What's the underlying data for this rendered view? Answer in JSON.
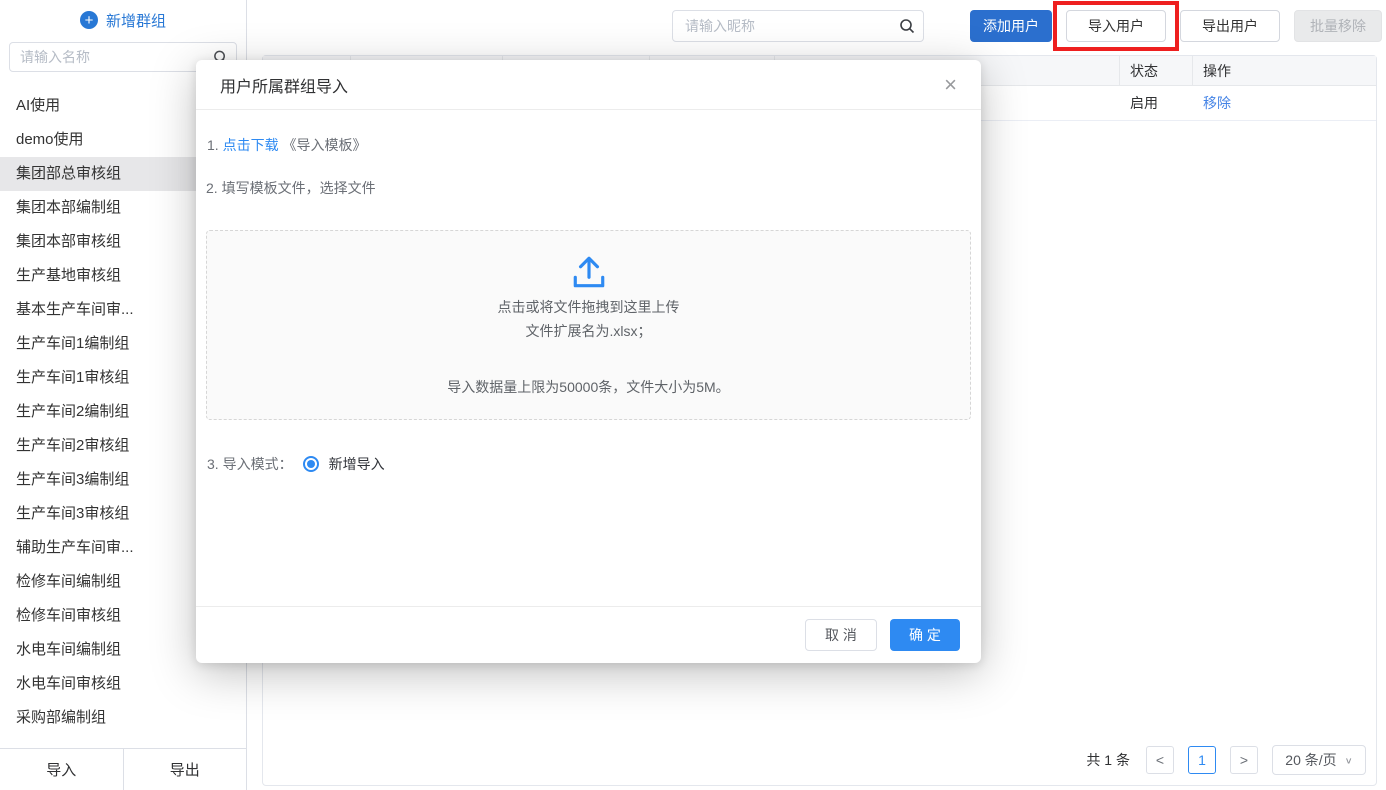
{
  "sidebar": {
    "add_group_label": "新增群组",
    "search_placeholder": "请输入名称",
    "groups": [
      "AI使用",
      "demo使用",
      "集团部总审核组",
      "集团本部编制组",
      "集团本部审核组",
      "生产基地审核组",
      "基本生产车间审...",
      "生产车间1编制组",
      "生产车间1审核组",
      "生产车间2编制组",
      "生产车间2审核组",
      "生产车间3编制组",
      "生产车间3审核组",
      "辅助生产车间审...",
      "检修车间编制组",
      "检修车间审核组",
      "水电车间编制组",
      "水电车间审核组",
      "采购部编制组"
    ],
    "selected_group": "集团部总审核组",
    "import_label": "导入",
    "export_label": "导出"
  },
  "toolbar": {
    "search_placeholder": "请输入昵称",
    "add_user_label": "添加用户",
    "import_user_label": "导入用户",
    "export_user_label": "导出用户",
    "batch_remove_label": "批量移除"
  },
  "table": {
    "headers": [
      "状态",
      "操作"
    ],
    "rows": [
      {
        "status": "启用",
        "action": "移除"
      }
    ]
  },
  "pagination": {
    "total_label": "共 1 条",
    "current_page": "1",
    "page_size_label": "20 条/页"
  },
  "modal": {
    "title": "用户所属群组导入",
    "step1_prefix": "1. ",
    "step1_link": "点击下载",
    "step1_suffix": " 《导入模板》",
    "step2": "2. 填写模板文件，选择文件",
    "upload_line1": "点击或将文件拖拽到这里上传",
    "upload_line2": "文件扩展名为.xlsx；",
    "upload_line3": "导入数据量上限为50000条，文件大小为5M。",
    "step3_label": "3. 导入模式：",
    "radio_label": "新增导入",
    "radio_selected": true,
    "cancel_label": "取 消",
    "confirm_label": "确 定"
  },
  "icons": {
    "plus": "+",
    "close": "×",
    "prev": "<",
    "next": ">",
    "chevron_down": "∨"
  },
  "annotation": {
    "shape": "rectangle",
    "color": "#ee1f1f",
    "target": "import-user-button"
  },
  "colors": {
    "primary_dark": "#2b6fce",
    "primary_bright": "#2e8af2",
    "link_blue": "#4584e6",
    "annotation_red": "#ee1f1f",
    "sidebar_selected_bg": "#e7e7e9",
    "table_header_bg": "#f6f7f9"
  }
}
